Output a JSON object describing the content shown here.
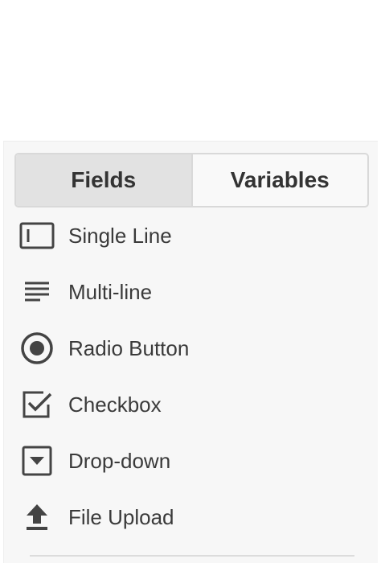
{
  "tabs": [
    {
      "label": "Fields",
      "active": true
    },
    {
      "label": "Variables",
      "active": false
    }
  ],
  "fields": [
    {
      "label": "Single Line",
      "icon": "single-line-icon"
    },
    {
      "label": "Multi-line",
      "icon": "multi-line-icon"
    },
    {
      "label": "Radio Button",
      "icon": "radio-button-icon"
    },
    {
      "label": "Checkbox",
      "icon": "checkbox-icon"
    },
    {
      "label": "Drop-down",
      "icon": "dropdown-icon"
    },
    {
      "label": "File Upload",
      "icon": "file-upload-icon"
    }
  ],
  "colors": {
    "icon": "#444444",
    "text": "#3a3a3a",
    "active_tab": "#e2e2e2",
    "panel_bg": "#f7f7f7"
  }
}
